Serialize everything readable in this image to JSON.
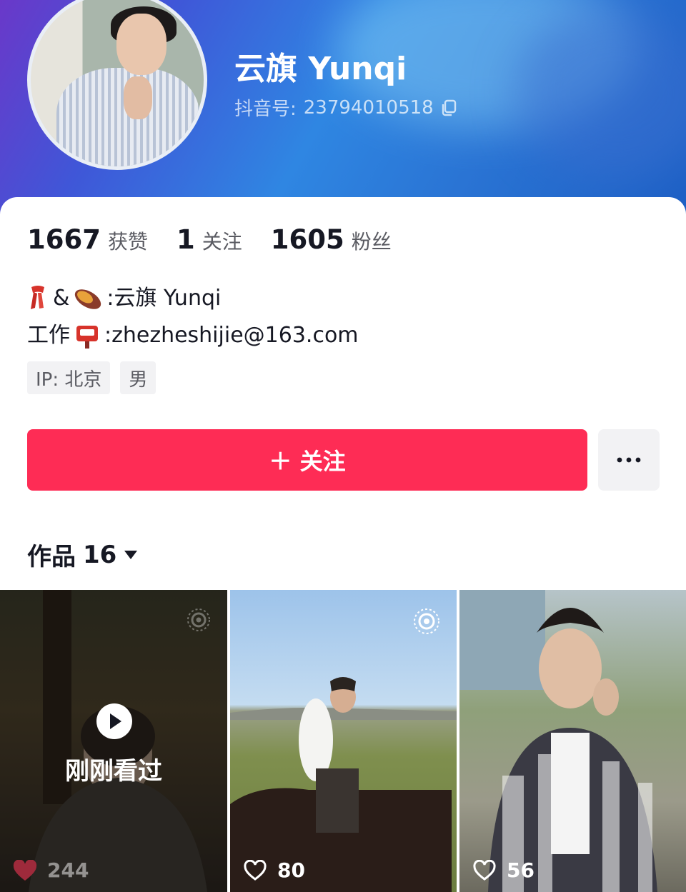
{
  "profile": {
    "name": "云旗 Yunqi",
    "douyin_id_label": "抖音号:",
    "douyin_id": "23794010518"
  },
  "stats": [
    {
      "value": "1667",
      "label": "获赞"
    },
    {
      "value": "1",
      "label": "关注"
    },
    {
      "value": "1605",
      "label": "粉丝"
    }
  ],
  "bio": {
    "line1_text": ":云旗 Yunqi",
    "line1_amp": "&",
    "line2_prefix": "工作",
    "line2_email": ":zhezheshijie@163.com"
  },
  "tags": [
    "IP: 北京",
    "男"
  ],
  "actions": {
    "follow_label": "＋ 关注"
  },
  "works": {
    "label": "作品",
    "count": "16"
  },
  "videos": [
    {
      "likes": "244",
      "overlay": "刚刚看过"
    },
    {
      "likes": "80"
    },
    {
      "likes": "56"
    }
  ],
  "colors": {
    "follow_button": "#fe2c55",
    "text_primary": "#161823",
    "tag_bg": "#f2f2f4"
  }
}
